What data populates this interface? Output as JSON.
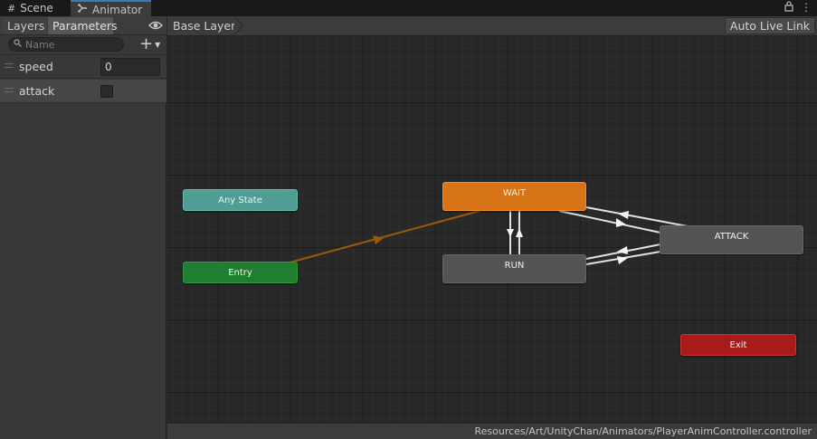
{
  "tabs": [
    {
      "label": "Scene",
      "icon": "grid-icon"
    },
    {
      "label": "Animator",
      "icon": "animator-icon"
    }
  ],
  "left_panel": {
    "tabs": [
      "Layers",
      "Parameters"
    ],
    "search": {
      "placeholder": "Name",
      "value": ""
    },
    "parameters": [
      {
        "name": "speed",
        "type": "float",
        "value": "0"
      },
      {
        "name": "attack",
        "type": "bool",
        "checked": false
      }
    ]
  },
  "graph": {
    "breadcrumb": "Base Layer",
    "auto_live_link": "Auto Live Link",
    "states": {
      "any_state": "Any State",
      "entry": "Entry",
      "wait": "WAIT",
      "run": "RUN",
      "attack": "ATTACK",
      "exit": "Exit"
    },
    "colors": {
      "default_state": "#d77418",
      "any_state": "#4f9d95",
      "entry": "#1f7e2f",
      "exit": "#a81b1b",
      "state": "#545454",
      "default_transition": "#9a5a0c",
      "transition": "#e0e0e0"
    },
    "transitions": [
      {
        "from": "Entry",
        "to": "WAIT"
      },
      {
        "from": "WAIT",
        "to": "RUN"
      },
      {
        "from": "RUN",
        "to": "WAIT"
      },
      {
        "from": "WAIT",
        "to": "ATTACK"
      },
      {
        "from": "ATTACK",
        "to": "WAIT"
      },
      {
        "from": "RUN",
        "to": "ATTACK"
      },
      {
        "from": "ATTACK",
        "to": "RUN"
      }
    ]
  },
  "status_bar": {
    "path": "Resources/Art/UnityChan/Animators/PlayerAnimController.controller"
  }
}
